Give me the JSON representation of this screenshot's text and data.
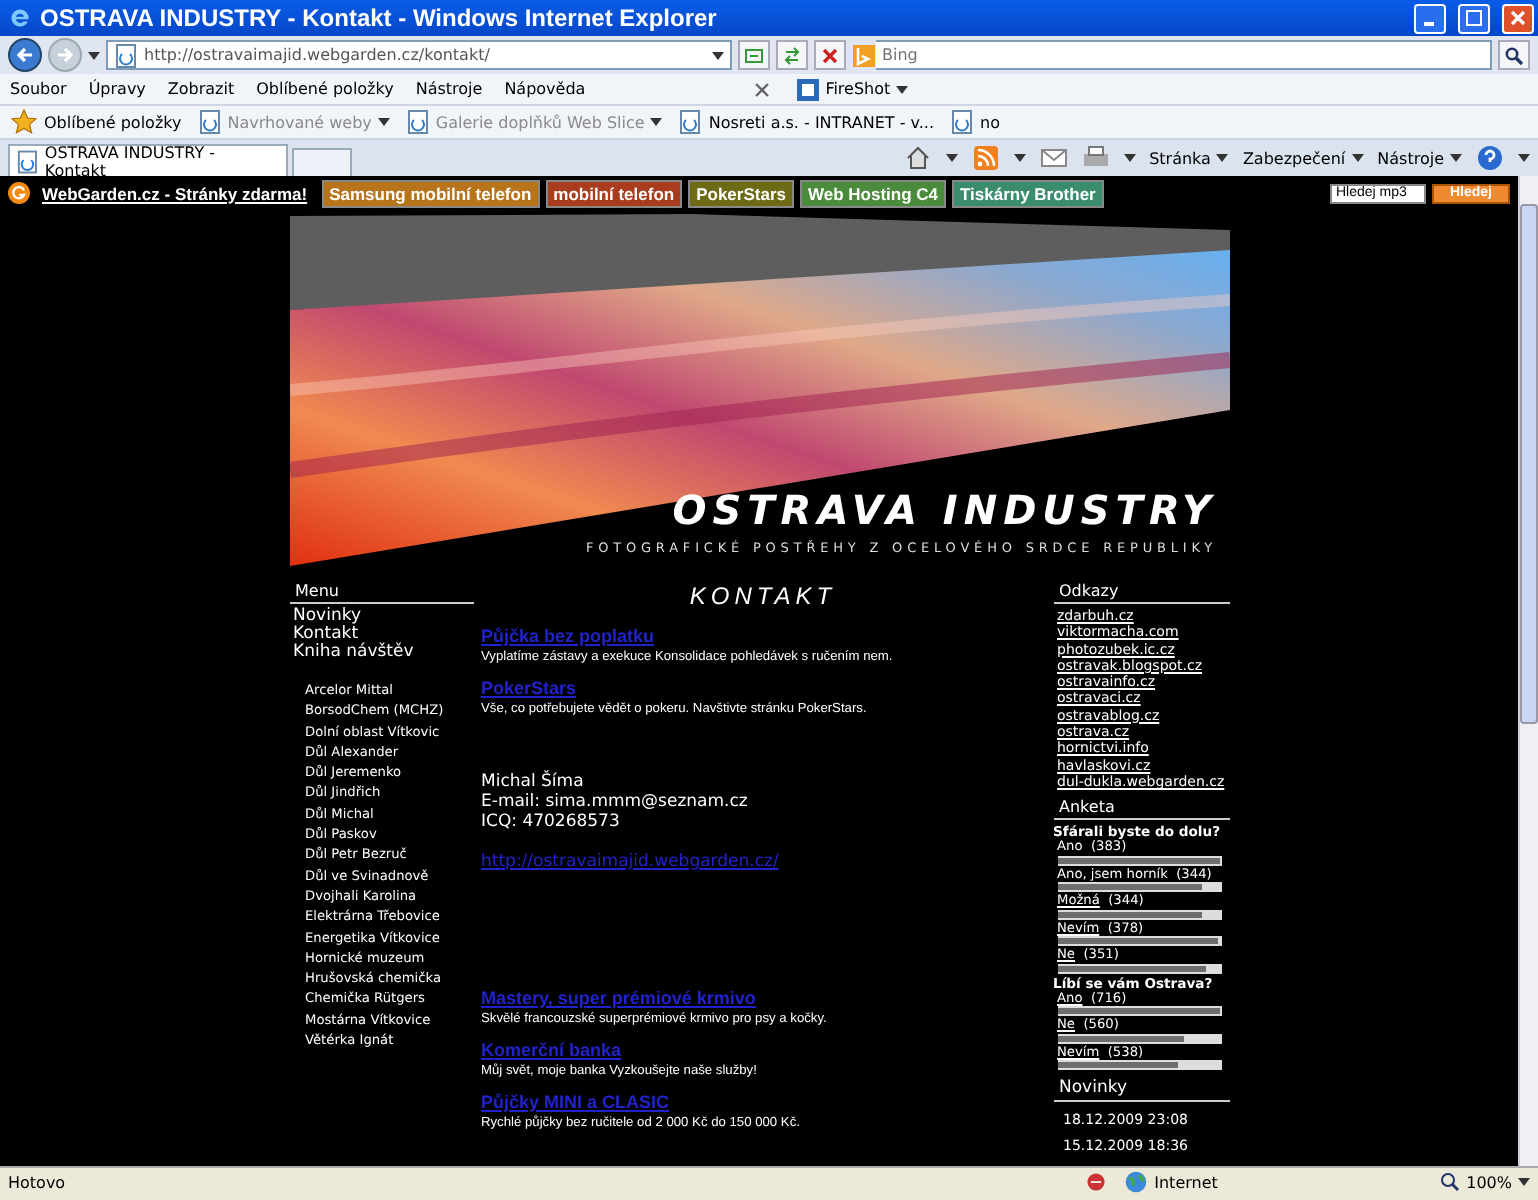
{
  "window": {
    "title": "OSTRAVA INDUSTRY - Kontakt - Windows Internet Explorer"
  },
  "address_bar": {
    "value": "http://ostravaimajid.webgarden.cz/kontakt/"
  },
  "search": {
    "placeholder": "Bing"
  },
  "menu_bar": [
    "Soubor",
    "Úpravy",
    "Zobrazit",
    "Oblíbené položky",
    "Nástroje",
    "Nápověda"
  ],
  "fireshot": {
    "label": "FireShot"
  },
  "favorites_bar": [
    {
      "label": "Oblíbené položky",
      "kind": "star"
    },
    {
      "label": "Navrhované weby",
      "kind": "dropdown"
    },
    {
      "label": "Galerie doplňků Web Slice",
      "kind": "dropdown"
    },
    {
      "label": "Nosreti a.s. - INTRANET - v...",
      "kind": "page"
    },
    {
      "label": "no",
      "kind": "page"
    }
  ],
  "tabs": [
    {
      "label": "OSTRAVA INDUSTRY - Kontakt",
      "selected": true
    }
  ],
  "command_bar": [
    "Stránka",
    "Zabezpečení",
    "Nástroje"
  ],
  "page": {
    "top_bar": {
      "brand": "WebGarden.cz - Stránky zdarma!",
      "ads": [
        {
          "label": "Samsung mobilní telefon",
          "color": "#b8741a"
        },
        {
          "label": "mobilní telefon",
          "color": "#a83c1c"
        },
        {
          "label": "PokerStars",
          "color": "#6c6a14"
        },
        {
          "label": "Web Hosting C4",
          "color": "#4a8c3c"
        },
        {
          "label": "Tiskárny Brother",
          "color": "#3a8c6c"
        }
      ],
      "search_value": "Hledej mp3",
      "search_button": "Hledej"
    },
    "banner": {
      "title": "OSTRAVA INDUSTRY",
      "subtitle": "FOTOGRAFICKÉ POSTŘEHY Z OCELOVÉHO SRDCE REPUBLIKY"
    },
    "menu": {
      "heading": "Menu",
      "items": [
        "Novinky",
        "Kontakt",
        "Kniha návštěv"
      ],
      "subitems": [
        "Arcelor Mittal",
        "BorsodChem (MCHZ)",
        "Dolní oblast Vítkovic",
        "Důl Alexander",
        "Důl Jeremenko",
        "Důl Jindřich",
        "Důl Michal",
        "Důl Paskov",
        "Důl Petr Bezruč",
        "Důl ve Svinadnově",
        "Dvojhali Karolina",
        "Elektrárna Třebovice",
        "Energetika Vítkovice",
        "Hornické muzeum",
        "Hrušovská chemička",
        "Chemička Rütgers",
        "Mostárna Vítkovice",
        "Větérka Ignát"
      ]
    },
    "content": {
      "heading": "KONTAKT",
      "ads_top": [
        {
          "title": "Půjčka bez poplatku",
          "text": "Vyplatíme zástavy a exekuce Konsolidace pohledávek s ručením nem."
        },
        {
          "title": "PokerStars",
          "text": "Vše, co potřebujete vědět o pokeru. Navštivte stránku PokerStars."
        }
      ],
      "contact": [
        "Michal Šíma",
        "E-mail: sima.mmm@seznam.cz",
        "ICQ: 470268573"
      ],
      "link": "http://ostravaimajid.webgarden.cz/",
      "ads_bottom": [
        {
          "title": "Mastery, super prémiové krmivo",
          "text": "Skvělé francouzské superprémiové krmivo pro psy a kočky."
        },
        {
          "title": "Komerční banka",
          "text": "Můj svět, moje banka Vyzkoušejte naše služby!"
        },
        {
          "title": "Půjčky MINI a CLASIC",
          "text": "Rychlé půjčky bez ručitele od 2 000 Kč do 150 000 Kč."
        }
      ]
    },
    "links": {
      "heading": "Odkazy",
      "items": [
        "zdarbuh.cz",
        "viktormacha.com",
        "photozubek.ic.cz",
        "ostravak.blogspot.cz",
        "ostravainfo.cz",
        "ostravaci.cz",
        "ostravablog.cz",
        "ostrava.cz",
        "hornictvi.info",
        "havlaskovi.cz",
        "dul-dukla.webgarden.cz"
      ]
    },
    "poll": {
      "heading": "Anketa",
      "questions": [
        {
          "question": "Sfárali byste do dolu?",
          "options": [
            {
              "label": "Ano",
              "count": "(383)",
              "link": false,
              "level": 1.0
            },
            {
              "label": "Ano, jsem horník",
              "count": "(344)",
              "link": false,
              "level": 0.9
            },
            {
              "label": "Možná",
              "count": "(344)",
              "link": true,
              "level": 0.9
            },
            {
              "label": "Nevím",
              "count": "(378)",
              "link": true,
              "level": 0.99
            },
            {
              "label": "Ne",
              "count": "(351)",
              "link": true,
              "level": 0.92
            }
          ]
        },
        {
          "question": "Líbí se vám Ostrava?",
          "options": [
            {
              "label": "Ano",
              "count": "(716)",
              "link": true,
              "level": 1.0
            },
            {
              "label": "Ne",
              "count": "(560)",
              "link": true,
              "level": 0.78
            },
            {
              "label": "Nevím",
              "count": "(538)",
              "link": true,
              "level": 0.75
            }
          ]
        }
      ]
    },
    "news": {
      "heading": "Novinky",
      "dates": [
        "18.12.2009 23:08",
        "15.12.2009 18:36"
      ]
    }
  },
  "status_bar": {
    "text": "Hotovo",
    "zone": "Internet",
    "zoom": "100%"
  }
}
